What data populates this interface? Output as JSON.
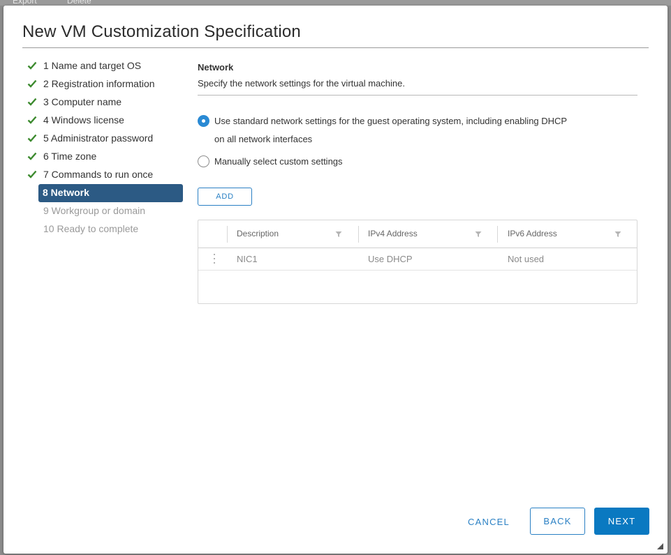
{
  "backdrop": {
    "item1": "Export",
    "item2": "Delete"
  },
  "dialog": {
    "title": "New VM Customization Specification"
  },
  "steps": [
    {
      "label": "1 Name and target OS",
      "state": "done"
    },
    {
      "label": "2 Registration information",
      "state": "done"
    },
    {
      "label": "3 Computer name",
      "state": "done"
    },
    {
      "label": "4 Windows license",
      "state": "done"
    },
    {
      "label": "5 Administrator password",
      "state": "done"
    },
    {
      "label": "6 Time zone",
      "state": "done"
    },
    {
      "label": "7 Commands to run once",
      "state": "done"
    },
    {
      "label": "8 Network",
      "state": "active"
    },
    {
      "label": "9 Workgroup or domain",
      "state": "pending"
    },
    {
      "label": "10 Ready to complete",
      "state": "pending"
    }
  ],
  "section": {
    "title": "Network",
    "description": "Specify the network settings for the virtual machine."
  },
  "options": {
    "standard_line1": "Use standard network settings for the guest operating system, including enabling DHCP",
    "standard_line2": "on all network interfaces",
    "standard_selected": true,
    "custom": "Manually select custom settings",
    "custom_selected": false
  },
  "add_button": "ADD",
  "grid": {
    "columns": [
      "Description",
      "IPv4 Address",
      "IPv6 Address"
    ],
    "rows": [
      {
        "description": "NIC1",
        "ipv4": "Use DHCP",
        "ipv6": "Not used"
      }
    ]
  },
  "footer": {
    "cancel": "CANCEL",
    "back": "BACK",
    "next": "NEXT"
  },
  "colors": {
    "accent": "#0a79c1",
    "active_step": "#2c5a84",
    "check": "#3c8a2e"
  },
  "icons": [
    "checkmark-icon",
    "filter-icon",
    "row-menu-icon",
    "resize-grip-icon"
  ]
}
